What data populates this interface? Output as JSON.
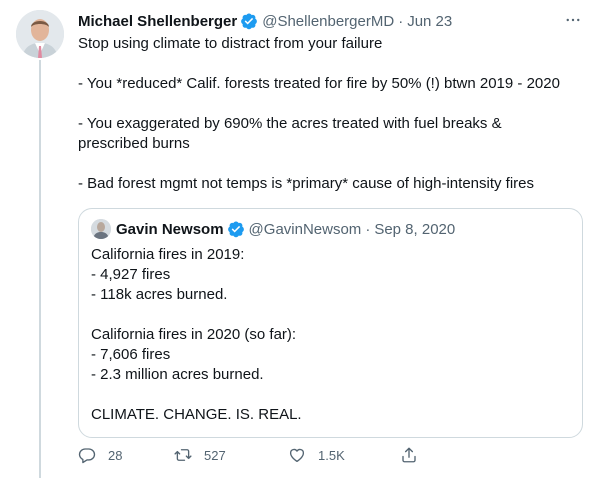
{
  "tweet": {
    "author_name": "Michael Shellenberger",
    "handle": "@ShellenbergerMD",
    "separator": "·",
    "time": "Jun 23",
    "lines": [
      "Stop using climate to distract from your failure",
      "",
      "- You *reduced* Calif. forests treated for fire by 50% (!) btwn 2019 - 2020",
      "",
      "- You exaggerated by 690% the acres treated with fuel breaks &",
      "prescribed burns",
      "",
      "- Bad forest mgmt not temps is *primary* cause of high-intensity fires"
    ]
  },
  "quote": {
    "author_name": "Gavin Newsom",
    "handle": "@GavinNewsom",
    "separator": "·",
    "time": "Sep 8, 2020",
    "lines": [
      "California fires in 2019:",
      "- 4,927 fires",
      "- 118k acres burned.",
      "",
      "California fires in 2020 (so far):",
      "- 7,606 fires",
      "- 2.3 million acres burned.",
      "",
      "CLIMATE. CHANGE. IS. REAL."
    ]
  },
  "actions": {
    "replies": "28",
    "retweets": "527",
    "likes": "1.5K"
  },
  "icons": {
    "verified": "verified-badge-icon",
    "more": "more-options-icon",
    "reply": "reply-icon",
    "retweet": "retweet-icon",
    "like": "heart-icon",
    "share": "share-icon"
  },
  "colors": {
    "verified": "#1d9bf0",
    "secondary_text": "#536471",
    "border": "#cfd9de"
  }
}
